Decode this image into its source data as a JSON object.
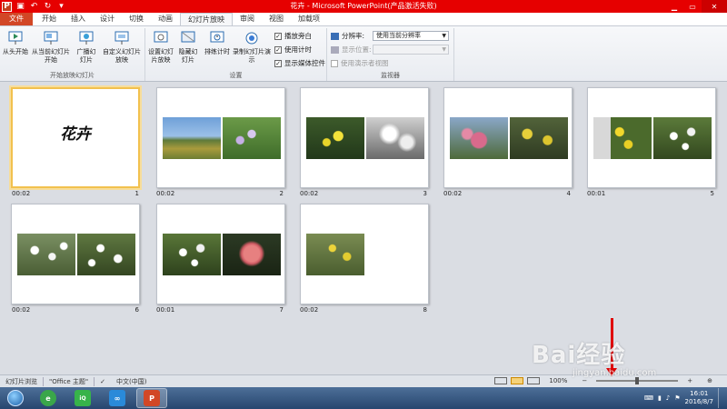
{
  "window": {
    "title": "花卉 - Microsoft PowerPoint(产品激活失败)"
  },
  "tabs": [
    {
      "label": "文件"
    },
    {
      "label": "开始"
    },
    {
      "label": "插入"
    },
    {
      "label": "设计"
    },
    {
      "label": "切换"
    },
    {
      "label": "动画"
    },
    {
      "label": "幻灯片放映"
    },
    {
      "label": "审阅"
    },
    {
      "label": "视图"
    },
    {
      "label": "加载项"
    }
  ],
  "ribbon": {
    "group_start": {
      "label": "开始放映幻灯片",
      "from_beginning": "从头开始",
      "from_current": "从当前幻灯片开始",
      "broadcast": "广播幻灯片",
      "custom": "自定义幻灯片放映"
    },
    "group_setup": {
      "label": "设置",
      "setup_show": "设置幻灯片放映",
      "hide_slide": "隐藏幻灯片",
      "rehearse": "排练计时",
      "record": "录制幻灯片演示",
      "play_narration": "播放旁白",
      "use_timings": "使用计时",
      "show_media": "显示媒体控件"
    },
    "group_monitor": {
      "label": "监视器",
      "resolution_label": "分辨率:",
      "resolution_value": "使用当前分辨率",
      "show_on_label": "显示位置:",
      "presenter_view": "使用演示者视图"
    }
  },
  "slides": [
    {
      "time": "00:02",
      "num": "1",
      "title": "花卉"
    },
    {
      "time": "00:02",
      "num": "2"
    },
    {
      "time": "00:02",
      "num": "3"
    },
    {
      "time": "00:02",
      "num": "4"
    },
    {
      "time": "00:01",
      "num": "5"
    },
    {
      "time": "00:02",
      "num": "6"
    },
    {
      "time": "00:01",
      "num": "7"
    },
    {
      "time": "00:02",
      "num": "8"
    }
  ],
  "status": {
    "view": "幻灯片浏览",
    "theme": "\"Office 主题\"",
    "language": "中文(中国)",
    "zoom": "100%"
  },
  "taskbar": {
    "time": "16:01",
    "date": "2016/8/7"
  },
  "watermark": {
    "brand": "Bai经验",
    "url": "jingyan.baidu.com"
  },
  "colors": {
    "titlebar": "#e60000",
    "file_tab": "#d24726",
    "selection": "#f2c14e"
  }
}
